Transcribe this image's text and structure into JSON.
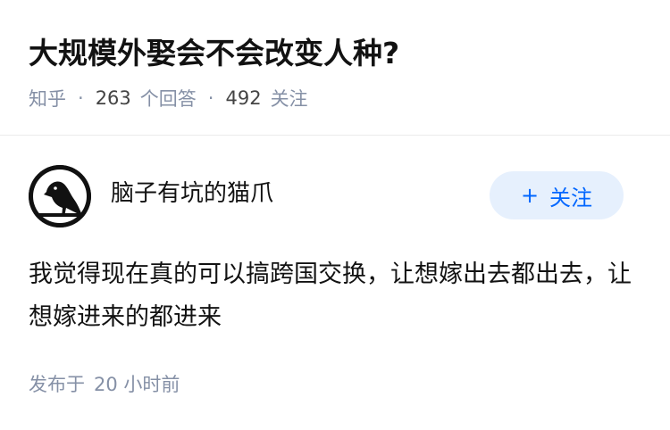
{
  "question": {
    "title": "大规模外娶会不会改变人种?",
    "source": "知乎",
    "answers_count": "263",
    "answers_label": "个回答",
    "followers_count": "492",
    "followers_label": "关注",
    "separator": "·"
  },
  "answer": {
    "author_name": "脑子有坑的猫爪",
    "follow_plus": "+",
    "follow_label": "关注",
    "content": "我觉得现在真的可以搞跨国交换，让想嫁出去都出去，让想嫁进来的都进来",
    "published_prefix": "发布于",
    "published_time": "20 小时前"
  },
  "colors": {
    "meta_gray": "#8590a6",
    "accent_blue": "#0066ff",
    "button_bg": "#e6f0fd"
  }
}
